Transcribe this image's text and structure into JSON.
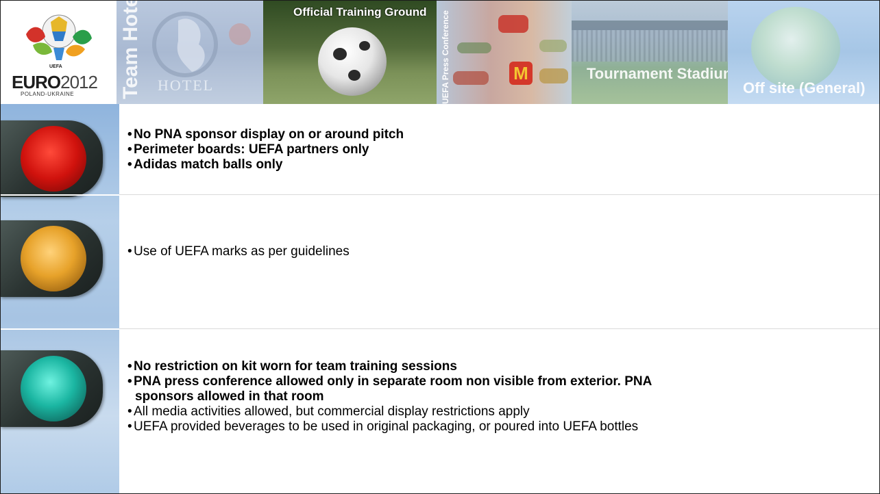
{
  "banner": {
    "tiles": [
      {
        "id": "logo",
        "lines": [
          "EURO",
          "2012",
          "POLAND-UKRAINE",
          "UEFA"
        ]
      },
      {
        "id": "hotel",
        "label": "Team Hotel",
        "sign": "HOTEL"
      },
      {
        "id": "training",
        "label": "Official Training Ground"
      },
      {
        "id": "press",
        "label": "UEFA Press Conference",
        "m_logo": "M"
      },
      {
        "id": "stadium",
        "label": "Tournament Stadium"
      },
      {
        "id": "offsite",
        "label": "Off site (General)"
      }
    ]
  },
  "sections": {
    "red": {
      "lamp": "red",
      "bullets": [
        {
          "text": "No PNA sponsor display on or around pitch",
          "bold": true
        },
        {
          "text": "Perimeter boards: UEFA partners only",
          "bold": true
        },
        {
          "text": "Adidas match balls only",
          "bold": true
        }
      ]
    },
    "amber": {
      "lamp": "amber",
      "bullets": [
        {
          "text": "Use of UEFA marks as per guidelines",
          "bold": false
        }
      ]
    },
    "green": {
      "lamp": "green",
      "bullets": [
        {
          "text": "No restriction on kit worn for team training sessions",
          "bold": true
        },
        {
          "text": "PNA press conference allowed only in separate room non visible from exterior. PNA",
          "cont": "sponsors allowed in that room",
          "bold": true
        },
        {
          "text": "All media activities allowed, but commercial display restrictions apply",
          "bold": false
        },
        {
          "text": "UEFA provided beverages to be used in original packaging, or poured into UEFA bottles",
          "bold": false
        }
      ]
    }
  },
  "bullet_char": "•",
  "colors": {
    "lamp_red": "#d0120d",
    "lamp_amber": "#e7a22a",
    "lamp_green": "#1bb6a2",
    "sky": "#a7c4e3"
  }
}
